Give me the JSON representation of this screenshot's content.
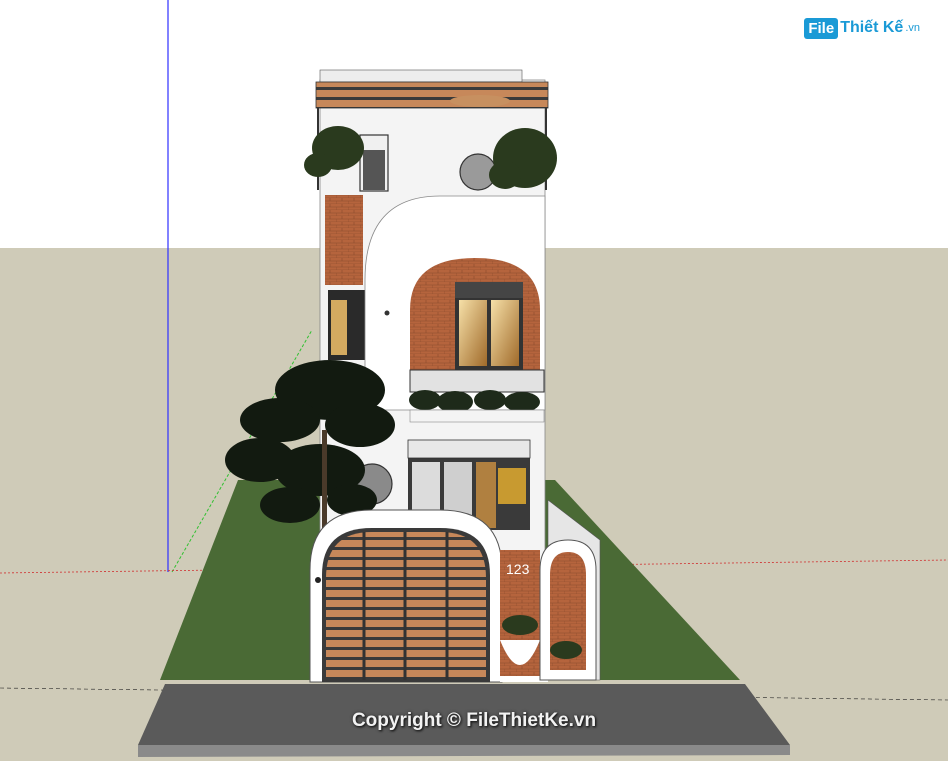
{
  "watermark": {
    "logo_file": "File",
    "logo_brand": "Thiết Kế",
    "logo_suffix": ".vn",
    "copyright": "Copyright © FileThietKe.vn"
  },
  "scene": {
    "house_number": "123",
    "colors": {
      "sky": "#ffffff",
      "ground": "#cfcbb8",
      "lawn": "#4a6a35",
      "road": "#5a5a5a",
      "wall": "#f4f4f4",
      "brick": "#b5643d",
      "frame": "#3c3c3c",
      "axis_blue": "#3030ff",
      "axis_green": "#30c030",
      "axis_red": "#d03030"
    }
  }
}
